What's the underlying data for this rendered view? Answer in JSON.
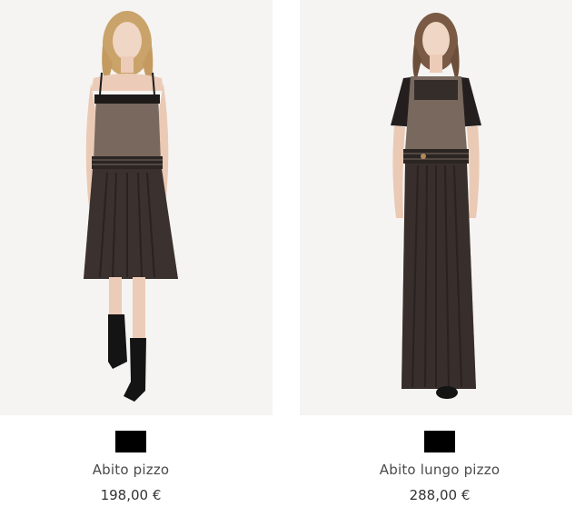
{
  "products": [
    {
      "name": "Abito pizzo",
      "price": "198,00 €",
      "swatch_color": "#000000"
    },
    {
      "name": "Abito lungo pizzo",
      "price": "288,00 €",
      "swatch_color": "#000000"
    }
  ],
  "colors": {
    "photo_background": "#f5f4f2",
    "text": "#4a4a4a"
  }
}
